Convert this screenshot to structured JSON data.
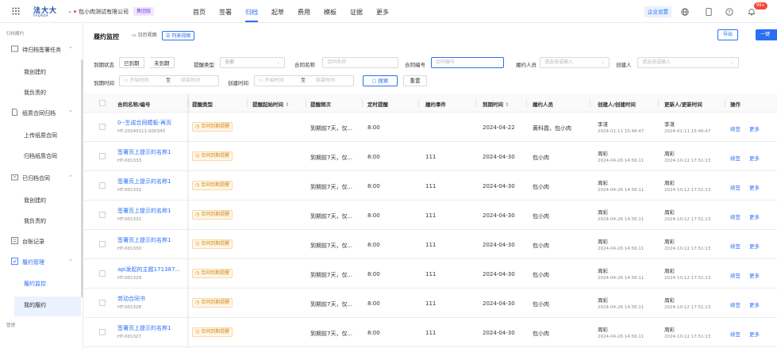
{
  "topbar": {
    "logo_cn": "法大大",
    "logo_en": "FADADA",
    "company": "包小肉测试有限公司",
    "group_badge": "集团版",
    "nav": [
      "首页",
      "签署",
      "归档",
      "起草",
      "费用",
      "模板",
      "证据",
      "更多"
    ],
    "active_nav": "归档",
    "enterprise_settings": "企业设置",
    "notification_count": "99+"
  },
  "sidebar": {
    "section1": "归档履约",
    "groups": [
      {
        "label": "待归档签署任务",
        "items": [
          "我创建的",
          "我负责的"
        ]
      },
      {
        "label": "纸质合同归档",
        "items": [
          "上传纸质合同",
          "归档纸质合同"
        ]
      },
      {
        "label": "已归档合同",
        "items": [
          "我创建的",
          "我负责的"
        ]
      },
      {
        "label": "台账记录",
        "items": []
      },
      {
        "label": "履约管理",
        "items": [
          "履约监控",
          "我的履约"
        ]
      }
    ],
    "section2": "管理",
    "active_item": "履约监控"
  },
  "main": {
    "title": "履约监控",
    "view_calendar": "日历视图",
    "view_list": "列表视图",
    "export": "导出",
    "batch": "一键"
  },
  "filters": {
    "due_status_label": "到期状态",
    "due_status_options": [
      "已到期",
      "未到期"
    ],
    "reminder_type_label": "提醒类型",
    "reminder_type_value": "全部",
    "contract_name_label": "合同名称",
    "contract_name_placeholder": "合同名称",
    "contract_no_label": "合同编号",
    "contract_no_placeholder": "合同编号",
    "person_label": "履约人员",
    "person_placeholder": "请选择或输入",
    "creator_label": "创建人",
    "creator_placeholder": "请选择或输入",
    "due_time_label": "到期时间",
    "start_placeholder": "开始时间",
    "to": "至",
    "end_placeholder": "结束时间",
    "created_time_label": "创建时间",
    "search": "搜索",
    "reset": "重置"
  },
  "table": {
    "headers": [
      "合同名称/编号",
      "提醒类型",
      "提醒起始时间",
      "提醒频次",
      "定时提醒",
      "履约事件",
      "到期时间",
      "履约人员",
      "创建人/创建时间",
      "更新人/更新时间",
      "操作"
    ],
    "rows": [
      {
        "name": "0--生成合同模板-再页",
        "code": "HT-20240111-000343",
        "tag": "合同到期提醒",
        "freq": "到期前7天，仅...",
        "time": "8:00",
        "event": "",
        "due": "2024-04-22",
        "person": "黄科霞，包小肉",
        "creator": "李湛",
        "created": "2024-01-11 15:46:47",
        "updater": "李湛",
        "updated": "2024-01-11 15:46:47",
        "actions": [
          "续签",
          "更多"
        ]
      },
      {
        "name": "签署页上提示的名称1",
        "code": "HT-001333",
        "tag": "合同到期提醒",
        "freq": "到期前7天，仅...",
        "time": "8:00",
        "event": "111",
        "due": "2024-04-30",
        "person": "包小肉",
        "creator": "周彩",
        "created": "2024-04-26 14:56:11",
        "updater": "周彩",
        "updated": "2024-10-12 17:51:13",
        "actions": [
          "续签",
          "更多"
        ]
      },
      {
        "name": "签署页上提示的名称1",
        "code": "HT-001332",
        "tag": "合同到期提醒",
        "freq": "到期前7天，仅...",
        "time": "8:00",
        "event": "111",
        "due": "2024-04-30",
        "person": "包小肉",
        "creator": "周彩",
        "created": "2024-04-26 14:56:11",
        "updater": "周彩",
        "updated": "2024-10-12 17:51:13",
        "actions": [
          "续签",
          "更多"
        ]
      },
      {
        "name": "签署页上提示的名称1",
        "code": "HT-001331",
        "tag": "合同到期提醒",
        "freq": "到期前7天，仅...",
        "time": "8:00",
        "event": "111",
        "due": "2024-04-30",
        "person": "包小肉",
        "creator": "周彩",
        "created": "2024-04-26 14:56:11",
        "updater": "周彩",
        "updated": "2024-10-12 17:51:13",
        "actions": [
          "续签",
          "更多"
        ]
      },
      {
        "name": "签署页上提示的名称1",
        "code": "HT-001330",
        "tag": "合同到期提醒",
        "freq": "到期前7天，仅...",
        "time": "8:00",
        "event": "111",
        "due": "2024-04-30",
        "person": "包小肉",
        "creator": "周彩",
        "created": "2024-04-26 14:56:11",
        "updater": "周彩",
        "updated": "2024-10-12 17:51:13",
        "actions": [
          "续签",
          "更多"
        ]
      },
      {
        "name": "api发起的主题171387...",
        "code": "HT-001329",
        "tag": "合同到期提醒",
        "freq": "到期前7天，仅...",
        "time": "8:00",
        "event": "111",
        "due": "2024-04-30",
        "person": "包小肉",
        "creator": "周彩",
        "created": "2024-04-26 14:56:11",
        "updater": "周彩",
        "updated": "2024-10-12 17:51:13",
        "actions": [
          "续签",
          "更多"
        ]
      },
      {
        "name": "劳动合同书",
        "code": "HT-001328",
        "tag": "合同到期提醒",
        "freq": "到期前7天，仅...",
        "time": "8:00",
        "event": "111",
        "due": "2024-04-30",
        "person": "包小肉",
        "creator": "周彩",
        "created": "2024-04-26 14:56:11",
        "updater": "周彩",
        "updated": "2024-10-12 17:51:13",
        "actions": [
          "续签",
          "更多"
        ]
      },
      {
        "name": "签署页上提示的名称1",
        "code": "HT-001327",
        "tag": "合同到期提醒",
        "freq": "到期前7天，仅...",
        "time": "8:00",
        "event": "111",
        "due": "2024-04-30",
        "person": "包小肉",
        "creator": "周彩",
        "created": "2024-04-26 14:56:11",
        "updater": "周彩",
        "updated": "2024-10-12 17:51:13",
        "actions": [
          "续签",
          "更多"
        ]
      }
    ]
  }
}
